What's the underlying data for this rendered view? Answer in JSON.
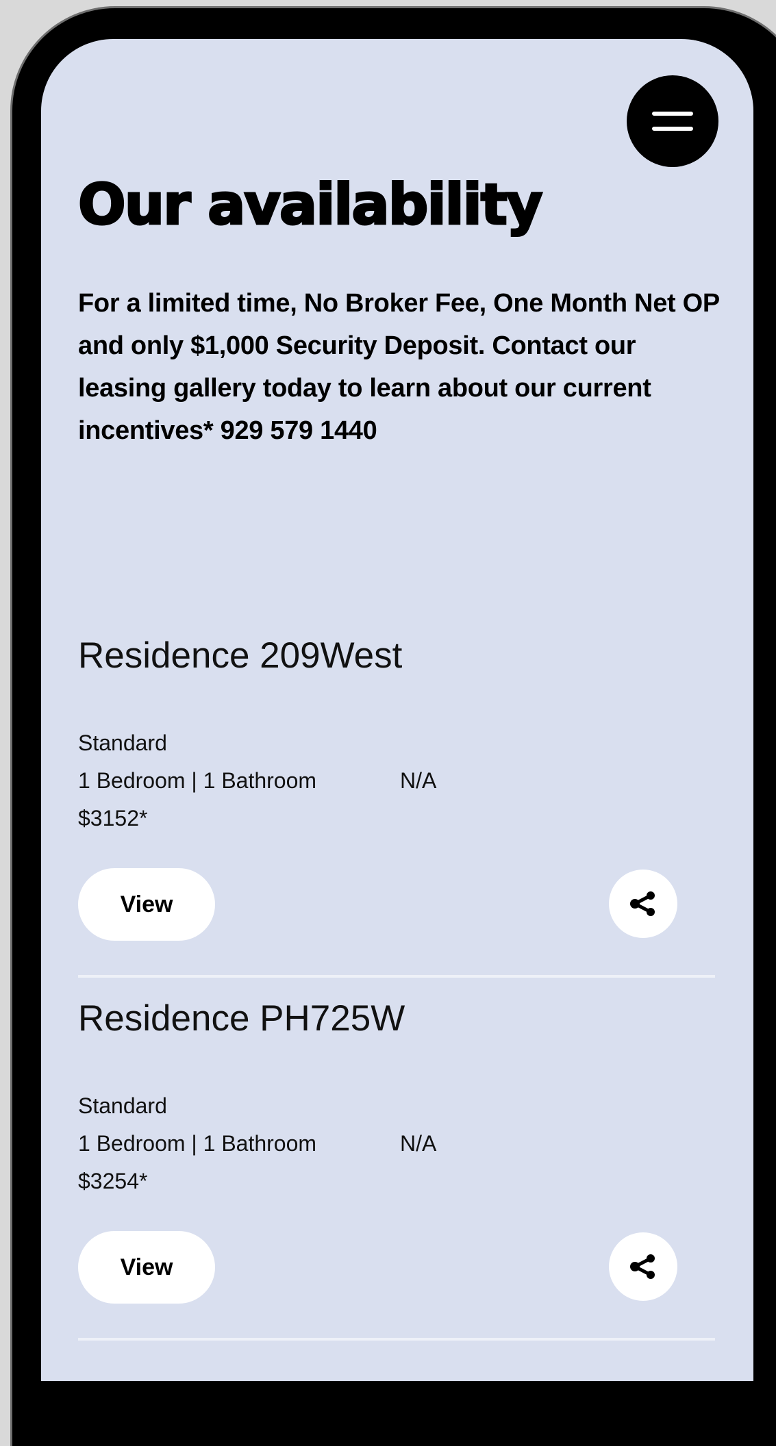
{
  "header": {
    "menu_icon": "hamburger-menu-icon",
    "title": "Our availability",
    "promo": "For a limited time, No Broker Fee, One Month Net OP and only $1,000 Security Deposit. Contact our leasing gallery today to learn about our current incentives* 929 579 1440"
  },
  "residences": [
    {
      "name": "Residence 209West",
      "type": "Standard",
      "rooms": "1 Bedroom | 1 Bathroom",
      "status": "N/A",
      "price": "$3152*",
      "view_label": "View",
      "share_icon": "share-icon"
    },
    {
      "name": "Residence PH725W",
      "type": "Standard",
      "rooms": "1 Bedroom | 1 Bathroom",
      "status": "N/A",
      "price": "$3254*",
      "view_label": "View",
      "share_icon": "share-icon"
    }
  ],
  "colors": {
    "screen_background": "#d9dfef",
    "frame": "#000000",
    "button_background": "#ffffff",
    "text": "#000000"
  }
}
